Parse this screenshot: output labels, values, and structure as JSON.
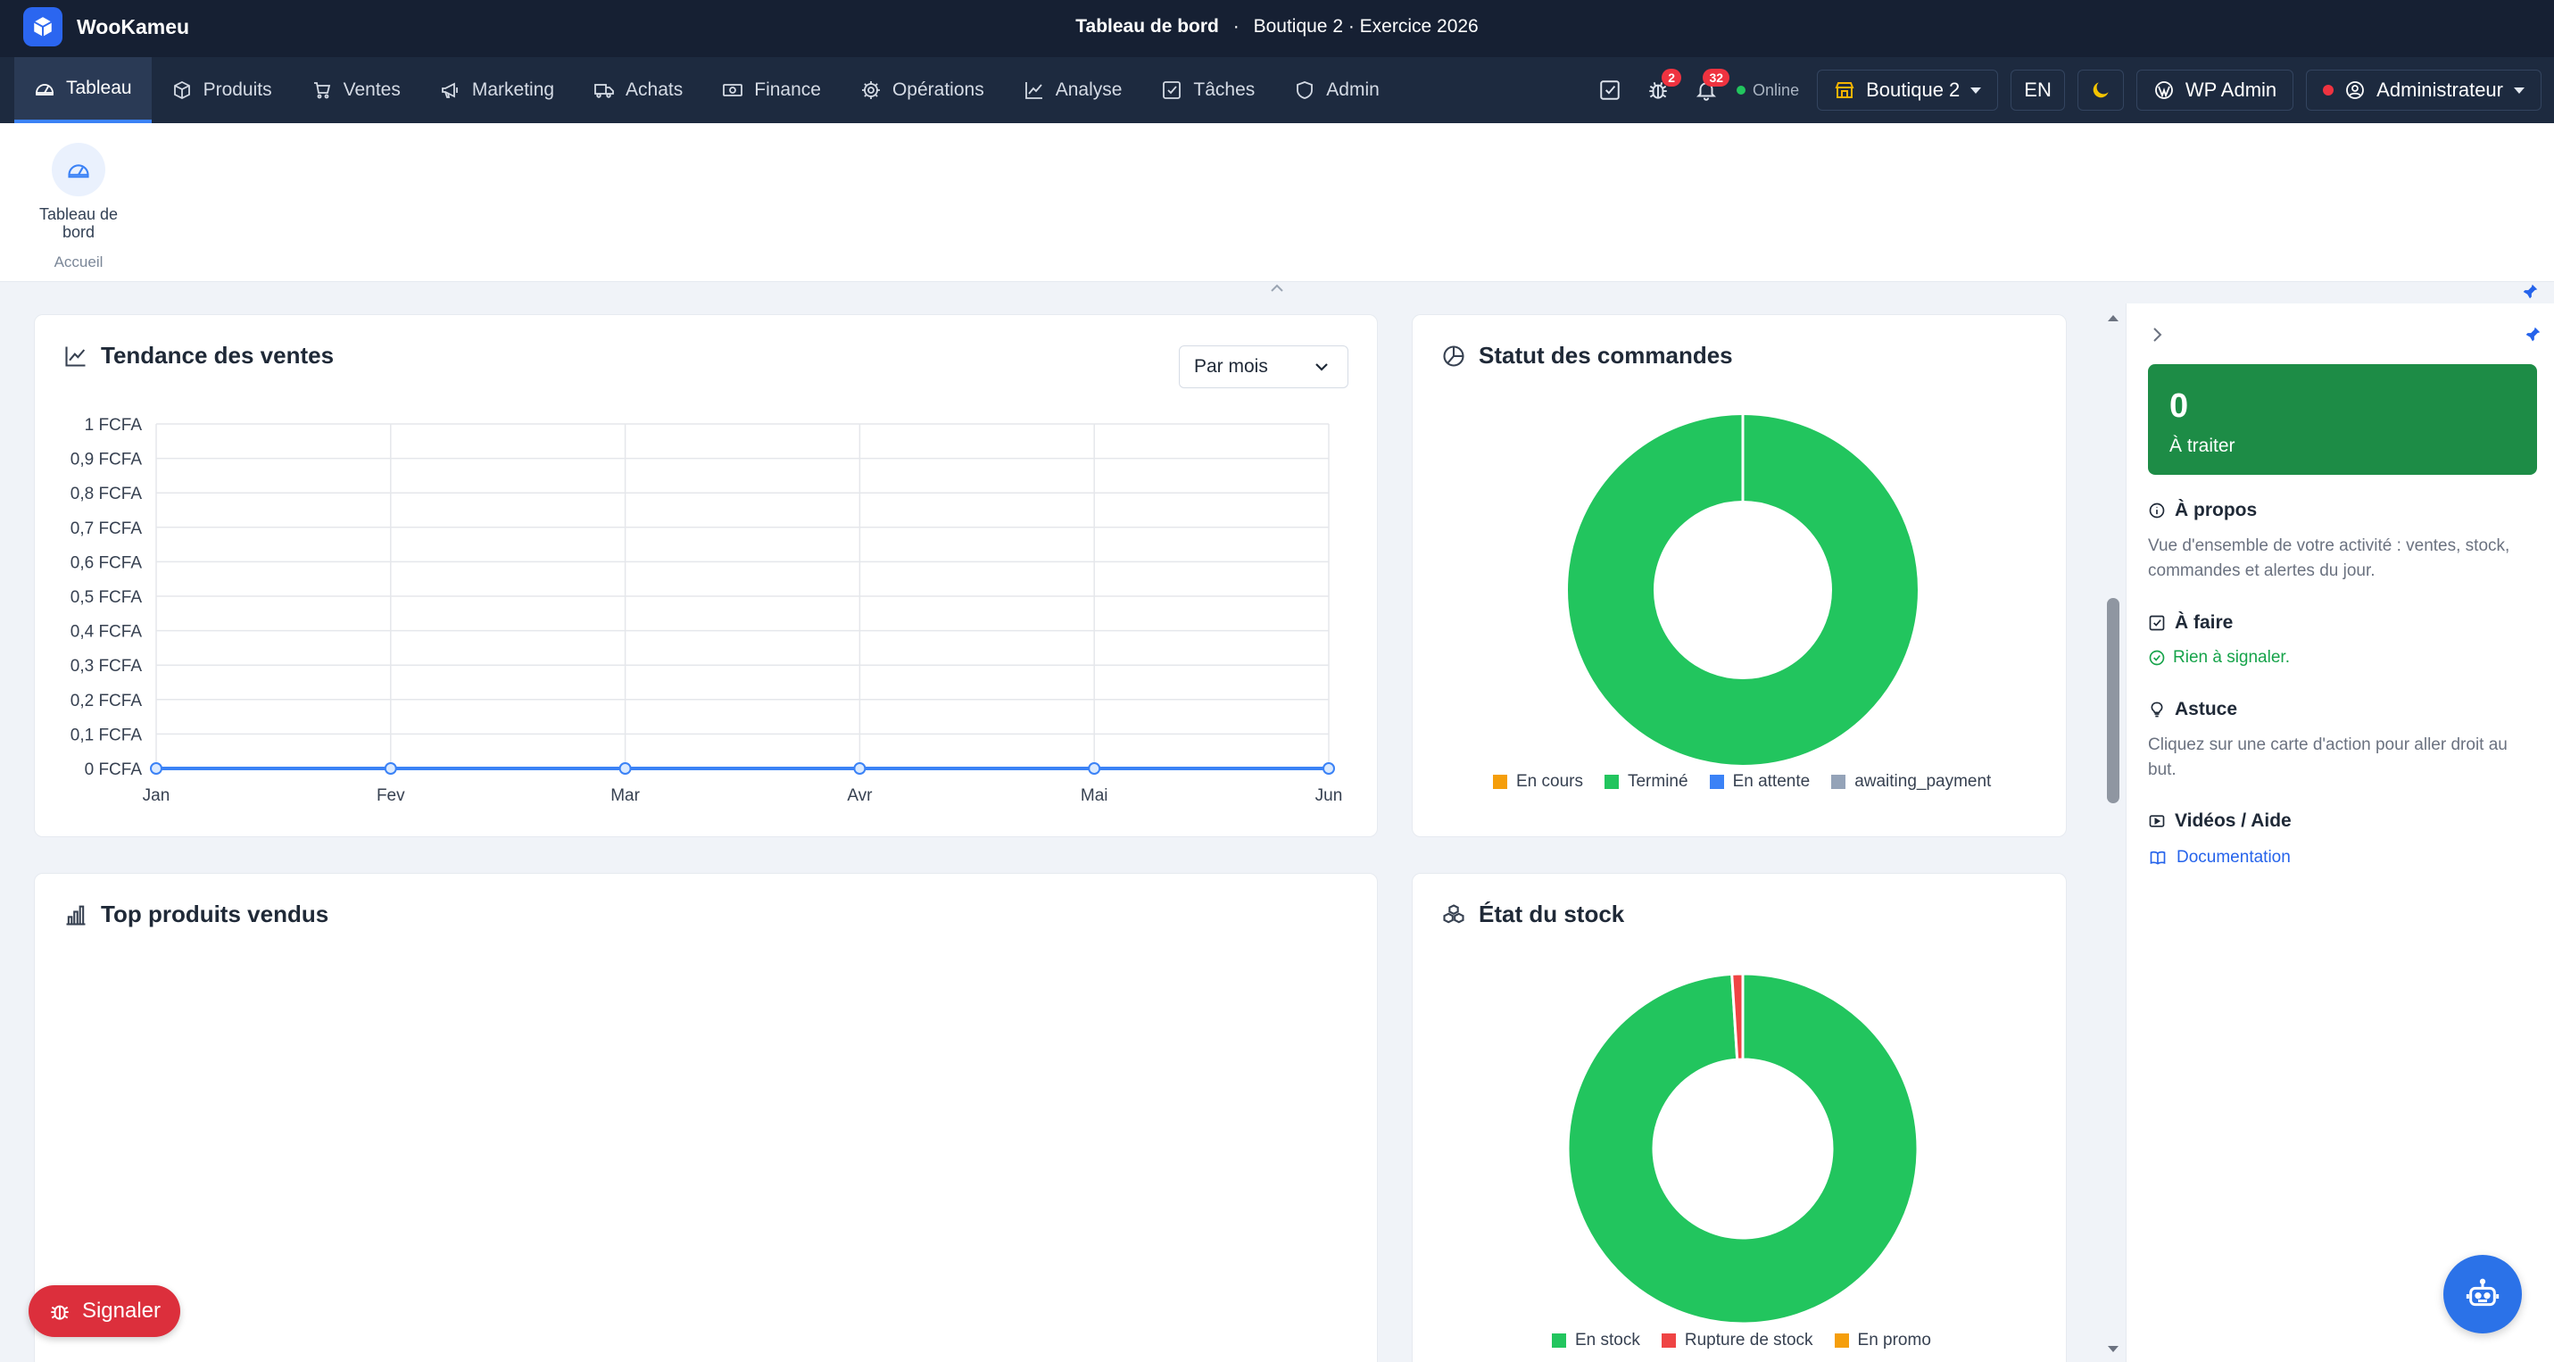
{
  "app": {
    "name": "WooKameu",
    "title_page": "Tableau de bord",
    "title_context": "Boutique 2 · Exercice 2026",
    "title_separator": "·"
  },
  "nav": {
    "tabs": [
      {
        "label": "Tableau",
        "icon": "gauge-icon",
        "active": true
      },
      {
        "label": "Produits",
        "icon": "box-icon"
      },
      {
        "label": "Ventes",
        "icon": "cart-icon"
      },
      {
        "label": "Marketing",
        "icon": "megaphone-icon"
      },
      {
        "label": "Achats",
        "icon": "truck-icon"
      },
      {
        "label": "Finance",
        "icon": "cash-icon"
      },
      {
        "label": "Opérations",
        "icon": "gear-icon"
      },
      {
        "label": "Analyse",
        "icon": "line-chart-icon"
      },
      {
        "label": "Tâches",
        "icon": "check-square-icon"
      },
      {
        "label": "Admin",
        "icon": "shield-icon"
      }
    ],
    "bug_badge": "2",
    "notifications_badge": "32",
    "status": "Online",
    "shop": "Boutique 2",
    "language": "EN",
    "wp_admin": "WP Admin",
    "user": "Administrateur"
  },
  "module": {
    "label": "Tableau de bord",
    "section": "Accueil"
  },
  "sales_trend": {
    "title": "Tendance des ventes",
    "period": "Par mois",
    "chart_data": {
      "type": "line",
      "categories": [
        "Jan",
        "Fev",
        "Mar",
        "Avr",
        "Mai",
        "Jun"
      ],
      "series": [
        {
          "values": [
            0,
            0,
            0,
            0,
            0,
            0
          ],
          "color": "#3b82f6"
        }
      ],
      "y_ticks": [
        "0 FCFA",
        "0,1 FCFA",
        "0,2 FCFA",
        "0,3 FCFA",
        "0,4 FCFA",
        "0,5 FCFA",
        "0,6 FCFA",
        "0,7 FCFA",
        "0,8 FCFA",
        "0,9 FCFA",
        "1 FCFA"
      ],
      "ylim": [
        0,
        1
      ],
      "grid": true
    }
  },
  "order_status": {
    "title": "Statut des commandes",
    "chart_data": {
      "type": "pie",
      "donut": true,
      "labels": [
        "En cours",
        "Terminé",
        "En attente",
        "awaiting_payment"
      ],
      "values": [
        0,
        100,
        0,
        0
      ],
      "colors": [
        "#f59e0b",
        "#22c55e",
        "#3b82f6",
        "#94a3b8"
      ],
      "legend": "bottom"
    }
  },
  "top_products": {
    "title": "Top produits vendus"
  },
  "stock_status": {
    "title": "État du stock",
    "chart_data": {
      "type": "pie",
      "donut": true,
      "labels": [
        "En stock",
        "Rupture de stock",
        "En promo"
      ],
      "values": [
        99,
        1,
        0
      ],
      "colors": [
        "#22c55e",
        "#ef4444",
        "#f59e0b"
      ],
      "legend": "bottom"
    }
  },
  "right_panel": {
    "count": "0",
    "count_label": "À traiter",
    "about_title": "À propos",
    "about_text": "Vue d'ensemble de votre activité : ventes, stock, commandes et alertes du jour.",
    "todo_title": "À faire",
    "todo_text": "Rien à signaler.",
    "tip_title": "Astuce",
    "tip_text": "Cliquez sur une carte d'action pour aller droit au but.",
    "videos_title": "Vidéos / Aide",
    "doc_link": "Documentation"
  },
  "signal_button": "Signaler",
  "colors": {
    "titlebar": "#162033",
    "navbar": "#1d2a3f",
    "accent": "#3b82f6",
    "green": "#22c55e",
    "danger": "#dc2f3c"
  }
}
